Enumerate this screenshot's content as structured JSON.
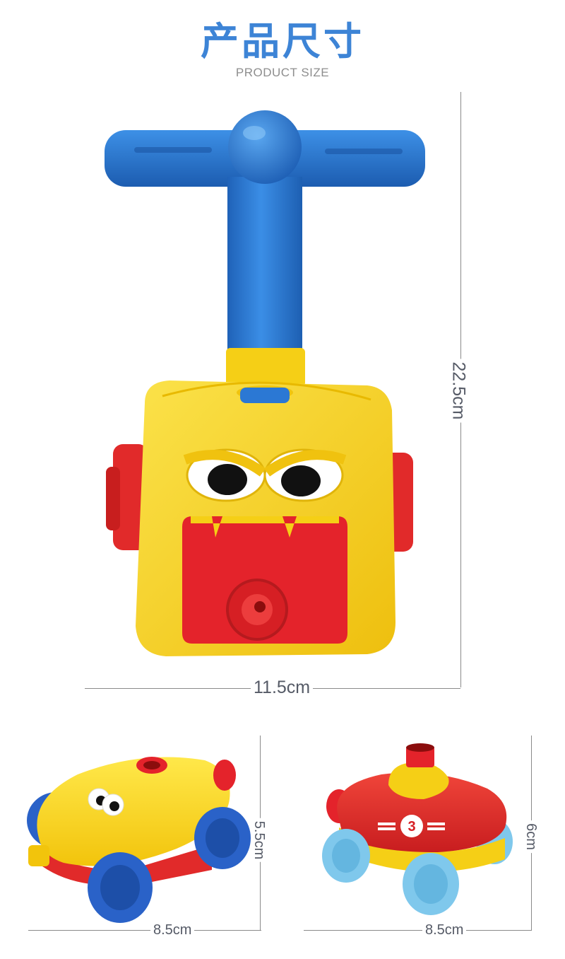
{
  "header": {
    "title": "产品尺寸",
    "subtitle": "PRODUCT SIZE"
  },
  "main_product": {
    "height_label": "22.5cm",
    "width_label": "11.5cm"
  },
  "car_left": {
    "height_label": "5.5cm",
    "width_label": "8.5cm"
  },
  "car_right": {
    "height_label": "6cm",
    "width_label": "8.5cm",
    "car_number": "3"
  },
  "colors": {
    "title": "#3d84d6",
    "toy_blue": "#2b78d4",
    "toy_yellow": "#f7d51a",
    "toy_red": "#e4232b",
    "wheel_light_blue": "#7fc8ec"
  },
  "icons": [
    "balloon-pump-toy",
    "yellow-balloon-car",
    "red-balloon-car"
  ]
}
